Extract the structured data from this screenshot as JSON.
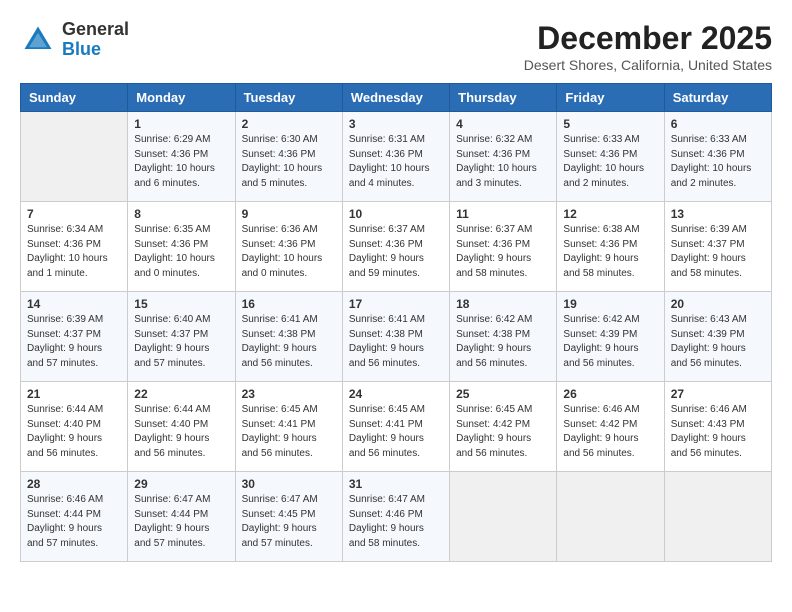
{
  "header": {
    "logo_general": "General",
    "logo_blue": "Blue",
    "title": "December 2025",
    "subtitle": "Desert Shores, California, United States"
  },
  "days_of_week": [
    "Sunday",
    "Monday",
    "Tuesday",
    "Wednesday",
    "Thursday",
    "Friday",
    "Saturday"
  ],
  "weeks": [
    [
      {
        "day": "",
        "detail": ""
      },
      {
        "day": "1",
        "detail": "Sunrise: 6:29 AM\nSunset: 4:36 PM\nDaylight: 10 hours\nand 6 minutes."
      },
      {
        "day": "2",
        "detail": "Sunrise: 6:30 AM\nSunset: 4:36 PM\nDaylight: 10 hours\nand 5 minutes."
      },
      {
        "day": "3",
        "detail": "Sunrise: 6:31 AM\nSunset: 4:36 PM\nDaylight: 10 hours\nand 4 minutes."
      },
      {
        "day": "4",
        "detail": "Sunrise: 6:32 AM\nSunset: 4:36 PM\nDaylight: 10 hours\nand 3 minutes."
      },
      {
        "day": "5",
        "detail": "Sunrise: 6:33 AM\nSunset: 4:36 PM\nDaylight: 10 hours\nand 2 minutes."
      },
      {
        "day": "6",
        "detail": "Sunrise: 6:33 AM\nSunset: 4:36 PM\nDaylight: 10 hours\nand 2 minutes."
      }
    ],
    [
      {
        "day": "7",
        "detail": "Sunrise: 6:34 AM\nSunset: 4:36 PM\nDaylight: 10 hours\nand 1 minute."
      },
      {
        "day": "8",
        "detail": "Sunrise: 6:35 AM\nSunset: 4:36 PM\nDaylight: 10 hours\nand 0 minutes."
      },
      {
        "day": "9",
        "detail": "Sunrise: 6:36 AM\nSunset: 4:36 PM\nDaylight: 10 hours\nand 0 minutes."
      },
      {
        "day": "10",
        "detail": "Sunrise: 6:37 AM\nSunset: 4:36 PM\nDaylight: 9 hours\nand 59 minutes."
      },
      {
        "day": "11",
        "detail": "Sunrise: 6:37 AM\nSunset: 4:36 PM\nDaylight: 9 hours\nand 58 minutes."
      },
      {
        "day": "12",
        "detail": "Sunrise: 6:38 AM\nSunset: 4:36 PM\nDaylight: 9 hours\nand 58 minutes."
      },
      {
        "day": "13",
        "detail": "Sunrise: 6:39 AM\nSunset: 4:37 PM\nDaylight: 9 hours\nand 58 minutes."
      }
    ],
    [
      {
        "day": "14",
        "detail": "Sunrise: 6:39 AM\nSunset: 4:37 PM\nDaylight: 9 hours\nand 57 minutes."
      },
      {
        "day": "15",
        "detail": "Sunrise: 6:40 AM\nSunset: 4:37 PM\nDaylight: 9 hours\nand 57 minutes."
      },
      {
        "day": "16",
        "detail": "Sunrise: 6:41 AM\nSunset: 4:38 PM\nDaylight: 9 hours\nand 56 minutes."
      },
      {
        "day": "17",
        "detail": "Sunrise: 6:41 AM\nSunset: 4:38 PM\nDaylight: 9 hours\nand 56 minutes."
      },
      {
        "day": "18",
        "detail": "Sunrise: 6:42 AM\nSunset: 4:38 PM\nDaylight: 9 hours\nand 56 minutes."
      },
      {
        "day": "19",
        "detail": "Sunrise: 6:42 AM\nSunset: 4:39 PM\nDaylight: 9 hours\nand 56 minutes."
      },
      {
        "day": "20",
        "detail": "Sunrise: 6:43 AM\nSunset: 4:39 PM\nDaylight: 9 hours\nand 56 minutes."
      }
    ],
    [
      {
        "day": "21",
        "detail": "Sunrise: 6:44 AM\nSunset: 4:40 PM\nDaylight: 9 hours\nand 56 minutes."
      },
      {
        "day": "22",
        "detail": "Sunrise: 6:44 AM\nSunset: 4:40 PM\nDaylight: 9 hours\nand 56 minutes."
      },
      {
        "day": "23",
        "detail": "Sunrise: 6:45 AM\nSunset: 4:41 PM\nDaylight: 9 hours\nand 56 minutes."
      },
      {
        "day": "24",
        "detail": "Sunrise: 6:45 AM\nSunset: 4:41 PM\nDaylight: 9 hours\nand 56 minutes."
      },
      {
        "day": "25",
        "detail": "Sunrise: 6:45 AM\nSunset: 4:42 PM\nDaylight: 9 hours\nand 56 minutes."
      },
      {
        "day": "26",
        "detail": "Sunrise: 6:46 AM\nSunset: 4:42 PM\nDaylight: 9 hours\nand 56 minutes."
      },
      {
        "day": "27",
        "detail": "Sunrise: 6:46 AM\nSunset: 4:43 PM\nDaylight: 9 hours\nand 56 minutes."
      }
    ],
    [
      {
        "day": "28",
        "detail": "Sunrise: 6:46 AM\nSunset: 4:44 PM\nDaylight: 9 hours\nand 57 minutes."
      },
      {
        "day": "29",
        "detail": "Sunrise: 6:47 AM\nSunset: 4:44 PM\nDaylight: 9 hours\nand 57 minutes."
      },
      {
        "day": "30",
        "detail": "Sunrise: 6:47 AM\nSunset: 4:45 PM\nDaylight: 9 hours\nand 57 minutes."
      },
      {
        "day": "31",
        "detail": "Sunrise: 6:47 AM\nSunset: 4:46 PM\nDaylight: 9 hours\nand 58 minutes."
      },
      {
        "day": "",
        "detail": ""
      },
      {
        "day": "",
        "detail": ""
      },
      {
        "day": "",
        "detail": ""
      }
    ]
  ]
}
